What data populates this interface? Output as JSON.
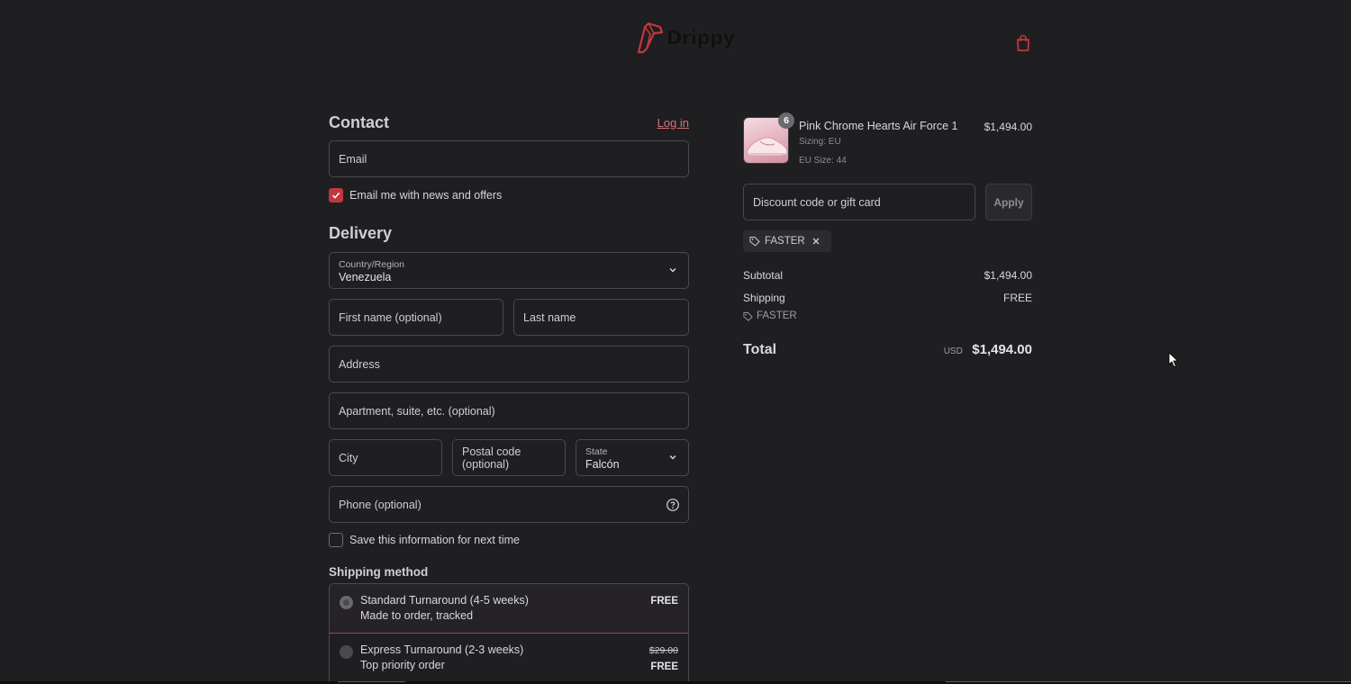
{
  "brand": {
    "name": "Drippy",
    "accent": "#c2373f"
  },
  "contact": {
    "title": "Contact",
    "login_link": "Log in",
    "email_placeholder": "Email",
    "newsletter_label": "Email me with news and offers",
    "newsletter_checked": true
  },
  "delivery": {
    "title": "Delivery",
    "country_label": "Country/Region",
    "country_value": "Venezuela",
    "first_name_placeholder": "First name (optional)",
    "last_name_placeholder": "Last name",
    "address_placeholder": "Address",
    "apartment_placeholder": "Apartment, suite, etc. (optional)",
    "city_placeholder": "City",
    "postal_placeholder": "Postal code (optional)",
    "state_label": "State",
    "state_value": "Falcón",
    "phone_placeholder": "Phone (optional)",
    "save_info_label": "Save this information for next time",
    "save_info_checked": false
  },
  "shipping": {
    "title": "Shipping method",
    "options": [
      {
        "name": "Standard Turnaround (4-5 weeks)",
        "sub": "Made to order, tracked",
        "price": "FREE",
        "original_price": "",
        "selected": true
      },
      {
        "name": "Express Turnaround (2-3 weeks)",
        "sub": "Top priority order",
        "price": "FREE",
        "original_price": "$29.00",
        "selected": false
      }
    ]
  },
  "summary": {
    "product": {
      "name": "Pink Chrome Hearts Air Force 1",
      "sizing": "Sizing: EU",
      "size": "EU Size: 44",
      "quantity": "6",
      "price": "$1,494.00"
    },
    "discount_placeholder": "Discount code or gift card",
    "apply_label": "Apply",
    "applied_code": "FASTER",
    "subtotal_label": "Subtotal",
    "subtotal_value": "$1,494.00",
    "shipping_label": "Shipping",
    "shipping_value": "FREE",
    "shipping_discount": "FASTER",
    "total_label": "Total",
    "currency": "USD",
    "total_value": "$1,494.00"
  }
}
